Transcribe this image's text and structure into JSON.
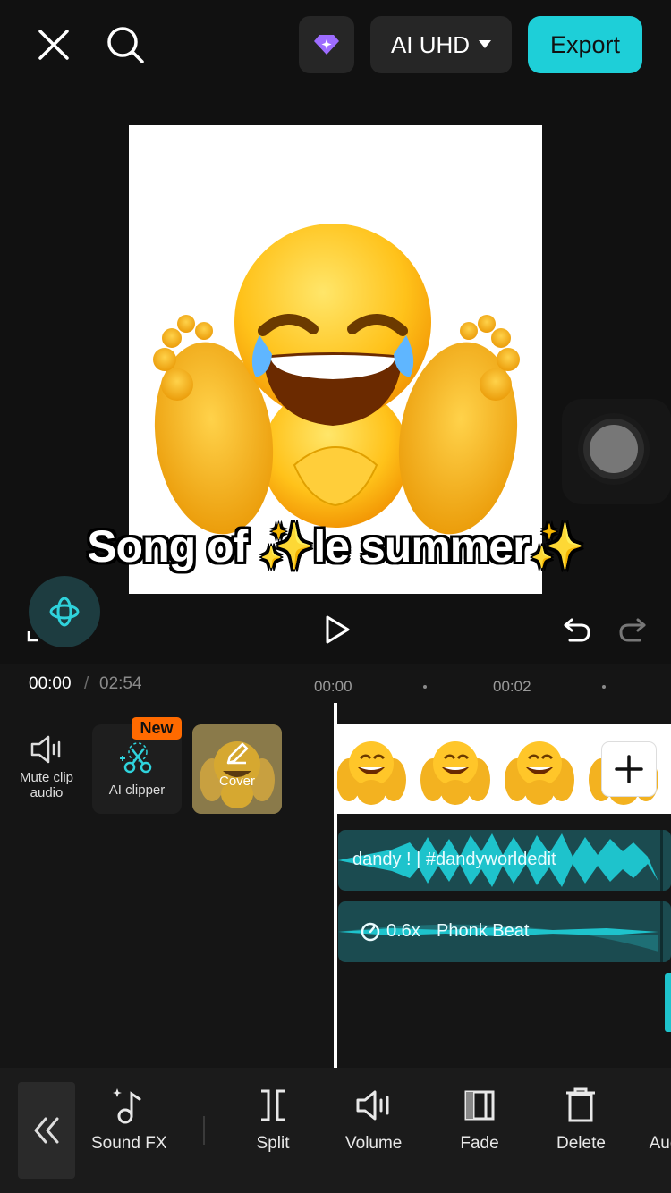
{
  "header": {
    "close_icon": "close-icon",
    "search_icon": "search-icon",
    "premium_icon": "diamond-icon",
    "quality_label": "AI UHD",
    "export_label": "Export",
    "accent": "#1ecfd8"
  },
  "preview": {
    "caption": "Song of ✨le summer✨"
  },
  "playback": {
    "play_icon": "play-icon",
    "undo_icon": "undo-icon",
    "redo_icon": "redo-icon"
  },
  "timeline": {
    "current_time": "00:00",
    "separator": "/",
    "total_time": "02:54",
    "ruler": [
      "00:00",
      "00:02"
    ]
  },
  "tools": {
    "mute_label": "Mute clip audio",
    "ai_clipper_label": "AI clipper",
    "new_badge": "New",
    "cover_label": "Cover"
  },
  "tracks": {
    "audio1_label": "dandy ! | #dandyworldedit",
    "audio2_speed": "0.6x",
    "audio2_label": "Phonk Beat"
  },
  "toolbar": {
    "items": [
      {
        "label": "Sound FX",
        "icon": "music-note-icon"
      },
      {
        "label": "Split",
        "icon": "split-icon"
      },
      {
        "label": "Volume",
        "icon": "volume-icon"
      },
      {
        "label": "Fade",
        "icon": "fade-icon"
      },
      {
        "label": "Delete",
        "icon": "delete-icon"
      },
      {
        "label": "Auc",
        "icon": ""
      }
    ]
  }
}
